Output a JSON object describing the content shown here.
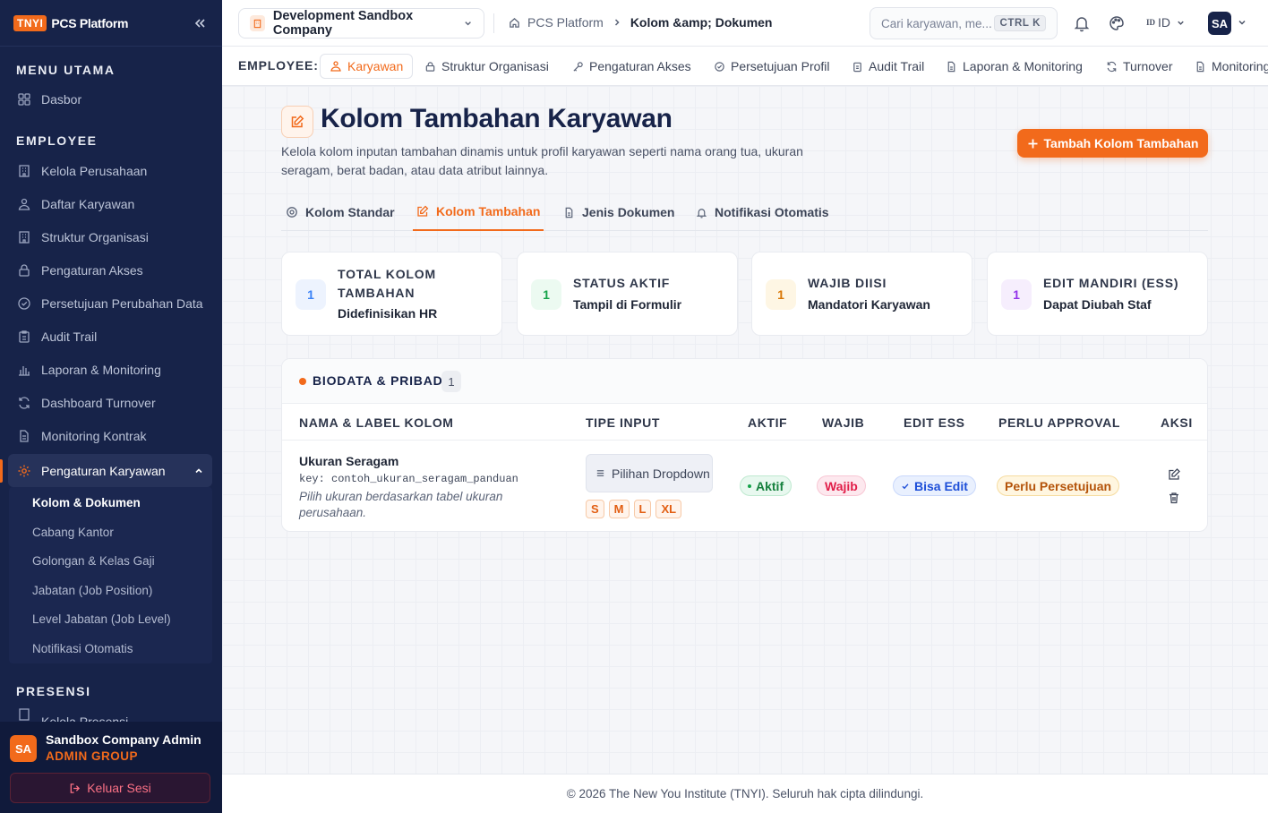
{
  "brand": {
    "badge": "TNYI",
    "name": "PCS Platform"
  },
  "sidebar": {
    "section_main": "MENU UTAMA",
    "dashboard": "Dasbor",
    "section_employee": "EMPLOYEE",
    "items": [
      {
        "label": "Kelola Perusahaan",
        "icon": "building-icon"
      },
      {
        "label": "Daftar Karyawan",
        "icon": "users-icon"
      },
      {
        "label": "Struktur Organisasi",
        "icon": "building-icon"
      },
      {
        "label": "Pengaturan Akses",
        "icon": "lock-icon"
      },
      {
        "label": "Persetujuan Perubahan Data",
        "icon": "check-circle-icon"
      },
      {
        "label": "Audit Trail",
        "icon": "clipboard-icon"
      },
      {
        "label": "Laporan & Monitoring",
        "icon": "chart-icon"
      },
      {
        "label": "Dashboard Turnover",
        "icon": "refresh-icon"
      },
      {
        "label": "Monitoring Kontrak",
        "icon": "document-icon"
      }
    ],
    "active_group": "Pengaturan Karyawan",
    "sub_items": [
      "Kolom & Dokumen",
      "Cabang Kantor",
      "Golongan & Kelas Gaji",
      "Jabatan (Job Position)",
      "Level Jabatan (Job Level)",
      "Notifikasi Otomatis"
    ],
    "section_presensi": "PRESENSI",
    "presensi_first": "Kelola Presensi",
    "user": {
      "initials": "SA",
      "name": "Sandbox Company Admin",
      "role": "ADMIN GROUP"
    },
    "logout": "Keluar Sesi"
  },
  "topbar": {
    "company": "Development Sandbox Company",
    "breadcrumb": {
      "root": "PCS Platform",
      "current": "Kolom &amp; Dokumen"
    },
    "search_placeholder": "Cari karyawan, me...",
    "search_shortcut": "CTRL K",
    "lang_flag": "ID",
    "lang": "ID",
    "avatar": "SA"
  },
  "module_nav": {
    "label": "EMPLOYEE:",
    "tabs": [
      "Karyawan",
      "Struktur Organisasi",
      "Pengaturan Akses",
      "Persetujuan Profil",
      "Audit Trail",
      "Laporan & Monitoring",
      "Turnover",
      "Monitoring"
    ]
  },
  "page": {
    "title": "Kolom Tambahan Karyawan",
    "description": "Kelola kolom inputan tambahan dinamis untuk profil karyawan seperti nama orang tua, ukuran seragam, berat badan, atau data atribut lainnya.",
    "add_button": "Tambah Kolom Tambahan",
    "tabs": [
      "Kolom Standar",
      "Kolom Tambahan",
      "Jenis Dokumen",
      "Notifikasi Otomatis"
    ],
    "active_tab": "Kolom Tambahan"
  },
  "stats": [
    {
      "value": "1",
      "label": "TOTAL KOLOM TAMBAHAN",
      "sub": "Didefinisikan HR",
      "color": "#3b82f6",
      "bg": "#edf3fe"
    },
    {
      "value": "1",
      "label": "STATUS AKTIF",
      "sub": "Tampil di Formulir",
      "color": "#16a34a",
      "bg": "#ecfaf1"
    },
    {
      "value": "1",
      "label": "WAJIB DIISI",
      "sub": "Mandatori Karyawan",
      "color": "#d97706",
      "bg": "#fef6e4"
    },
    {
      "value": "1",
      "label": "EDIT MANDIRI (ESS)",
      "sub": "Dapat Diubah Staf",
      "color": "#9333ea",
      "bg": "#f6eefd"
    }
  ],
  "group": {
    "name": "BIODATA & PRIBADI",
    "count": "1",
    "columns": [
      "NAMA & LABEL KOLOM",
      "TIPE INPUT",
      "AKTIF",
      "WAJIB",
      "EDIT ESS",
      "PERLU APPROVAL",
      "AKSI"
    ],
    "rows": [
      {
        "name": "Ukuran Seragam",
        "key": "key: contoh_ukuran_seragam_panduan",
        "hint": "Pilih ukuran berdasarkan tabel ukuran perusahaan.",
        "type": "Pilihan Dropdown",
        "options": [
          "S",
          "M",
          "L",
          "XL"
        ],
        "aktif": "Aktif",
        "wajib": "Wajib",
        "edit_ess": "Bisa Edit",
        "approval": "Perlu Persetujuan"
      }
    ]
  },
  "footer": "© 2026 The New You Institute (TNYI). Seluruh hak cipta dilindungi.",
  "colors": {
    "accent": "#f26a1b",
    "sidebar": "#172349"
  }
}
